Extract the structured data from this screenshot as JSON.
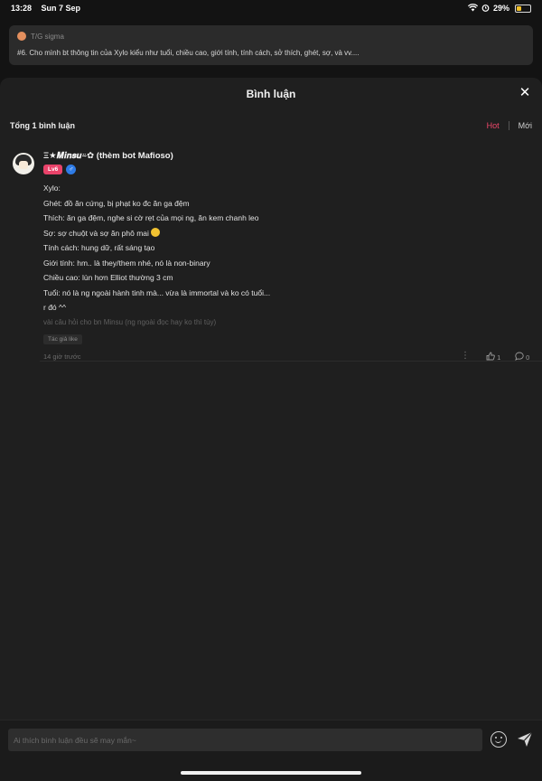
{
  "status": {
    "time": "13:28",
    "date": "Sun 7 Sep",
    "battery": "29%"
  },
  "quote": {
    "author": "T/G sigma",
    "text": "#6. Cho mình bt thông tin của Xylo kiểu như tuổi, chiều cao, giới tính, tính cách, sở thích, ghét, sợ, và vv...."
  },
  "panel": {
    "title": "Bình luận",
    "count_label": "Tổng 1 bình luận",
    "sort_hot": "Hot",
    "sort_new": "Mới"
  },
  "comment": {
    "username": "Ξ★𝑴𝒊𝒏𝒔𝒖⍨✿ (thèm bot Mafioso)",
    "level": "Lv6",
    "lines": [
      "Xylo:",
      "Ghét: đồ ăn cứng, bị phạt ko đc ăn ga đệm",
      "Thích: ăn ga đệm, nghe si cờ rẹt của mọi ng, ăn kem chanh leo",
      "Sợ: sợ chuột và sợ ăn phô mai",
      "Tính cách: hung dữ, rất sáng tạo",
      "Giới tính: hm.. là they/them nhé, nó là non-binary",
      "Chiều cao: lùn hơn Elliot thường 3 cm",
      "Tuổi: nó là ng ngoài hành tinh mà... vừa là immortal và ko có tuổi...",
      "r đó ^^"
    ],
    "reply_hint": "vài câu hỏi cho bn Minsu (ng ngoài đọc hay ko thì tùy)",
    "author_liked": "Tác giả like",
    "time": "14 giờ trước",
    "likes": "1",
    "replies": "0"
  },
  "composer": {
    "placeholder": "Ai thích bình luận đều sẽ may mắn~"
  }
}
